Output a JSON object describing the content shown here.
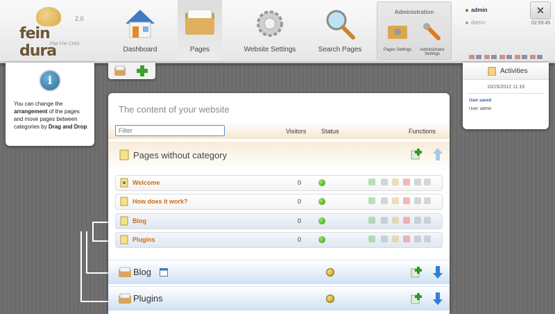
{
  "app": {
    "logo_text": "fein dura",
    "version": "2.0",
    "tagline": "Flat File CMS"
  },
  "nav": {
    "items": [
      {
        "label": "Dashboard",
        "icon": "house-icon"
      },
      {
        "label": "Pages",
        "icon": "folder-icon"
      },
      {
        "label": "Website Settings",
        "icon": "gear-icon"
      },
      {
        "label": "Search Pages",
        "icon": "magnifier-icon"
      }
    ],
    "administration": {
      "title": "Administration",
      "pages_settings": "Pages Settings",
      "administrator_settings": "Administrator Settings"
    }
  },
  "user": {
    "current": "admin",
    "other": "demo",
    "time": "02:59:45",
    "close": "✕"
  },
  "info": {
    "text_1": "You can change the ",
    "bold_1": "arrangement",
    "text_2": " of the pages and move pages between categories by ",
    "bold_2": "Drag and Drop",
    "text_3": "."
  },
  "activities": {
    "title": "Activities",
    "date": "10/15/2012 11:19",
    "message": "User saved",
    "user_line": "User: admin"
  },
  "main": {
    "title": "The content of your website",
    "filter_placeholder": "Filter",
    "columns": {
      "visitors": "Visitors",
      "status": "Status",
      "functions": "Functions"
    },
    "category_none": "Pages without category",
    "pages": [
      {
        "name": "Welcome",
        "visitors": "0"
      },
      {
        "name": "How does it work?",
        "visitors": "0"
      },
      {
        "name": "Blog",
        "visitors": "0"
      },
      {
        "name": "Plugins",
        "visitors": "0"
      }
    ],
    "categories": [
      {
        "name": "Blog"
      },
      {
        "name": "Plugins"
      }
    ]
  },
  "colors": {
    "accent": "#d06a16",
    "status_green": "#2f9a10",
    "link_blue": "#2e5d9b"
  }
}
